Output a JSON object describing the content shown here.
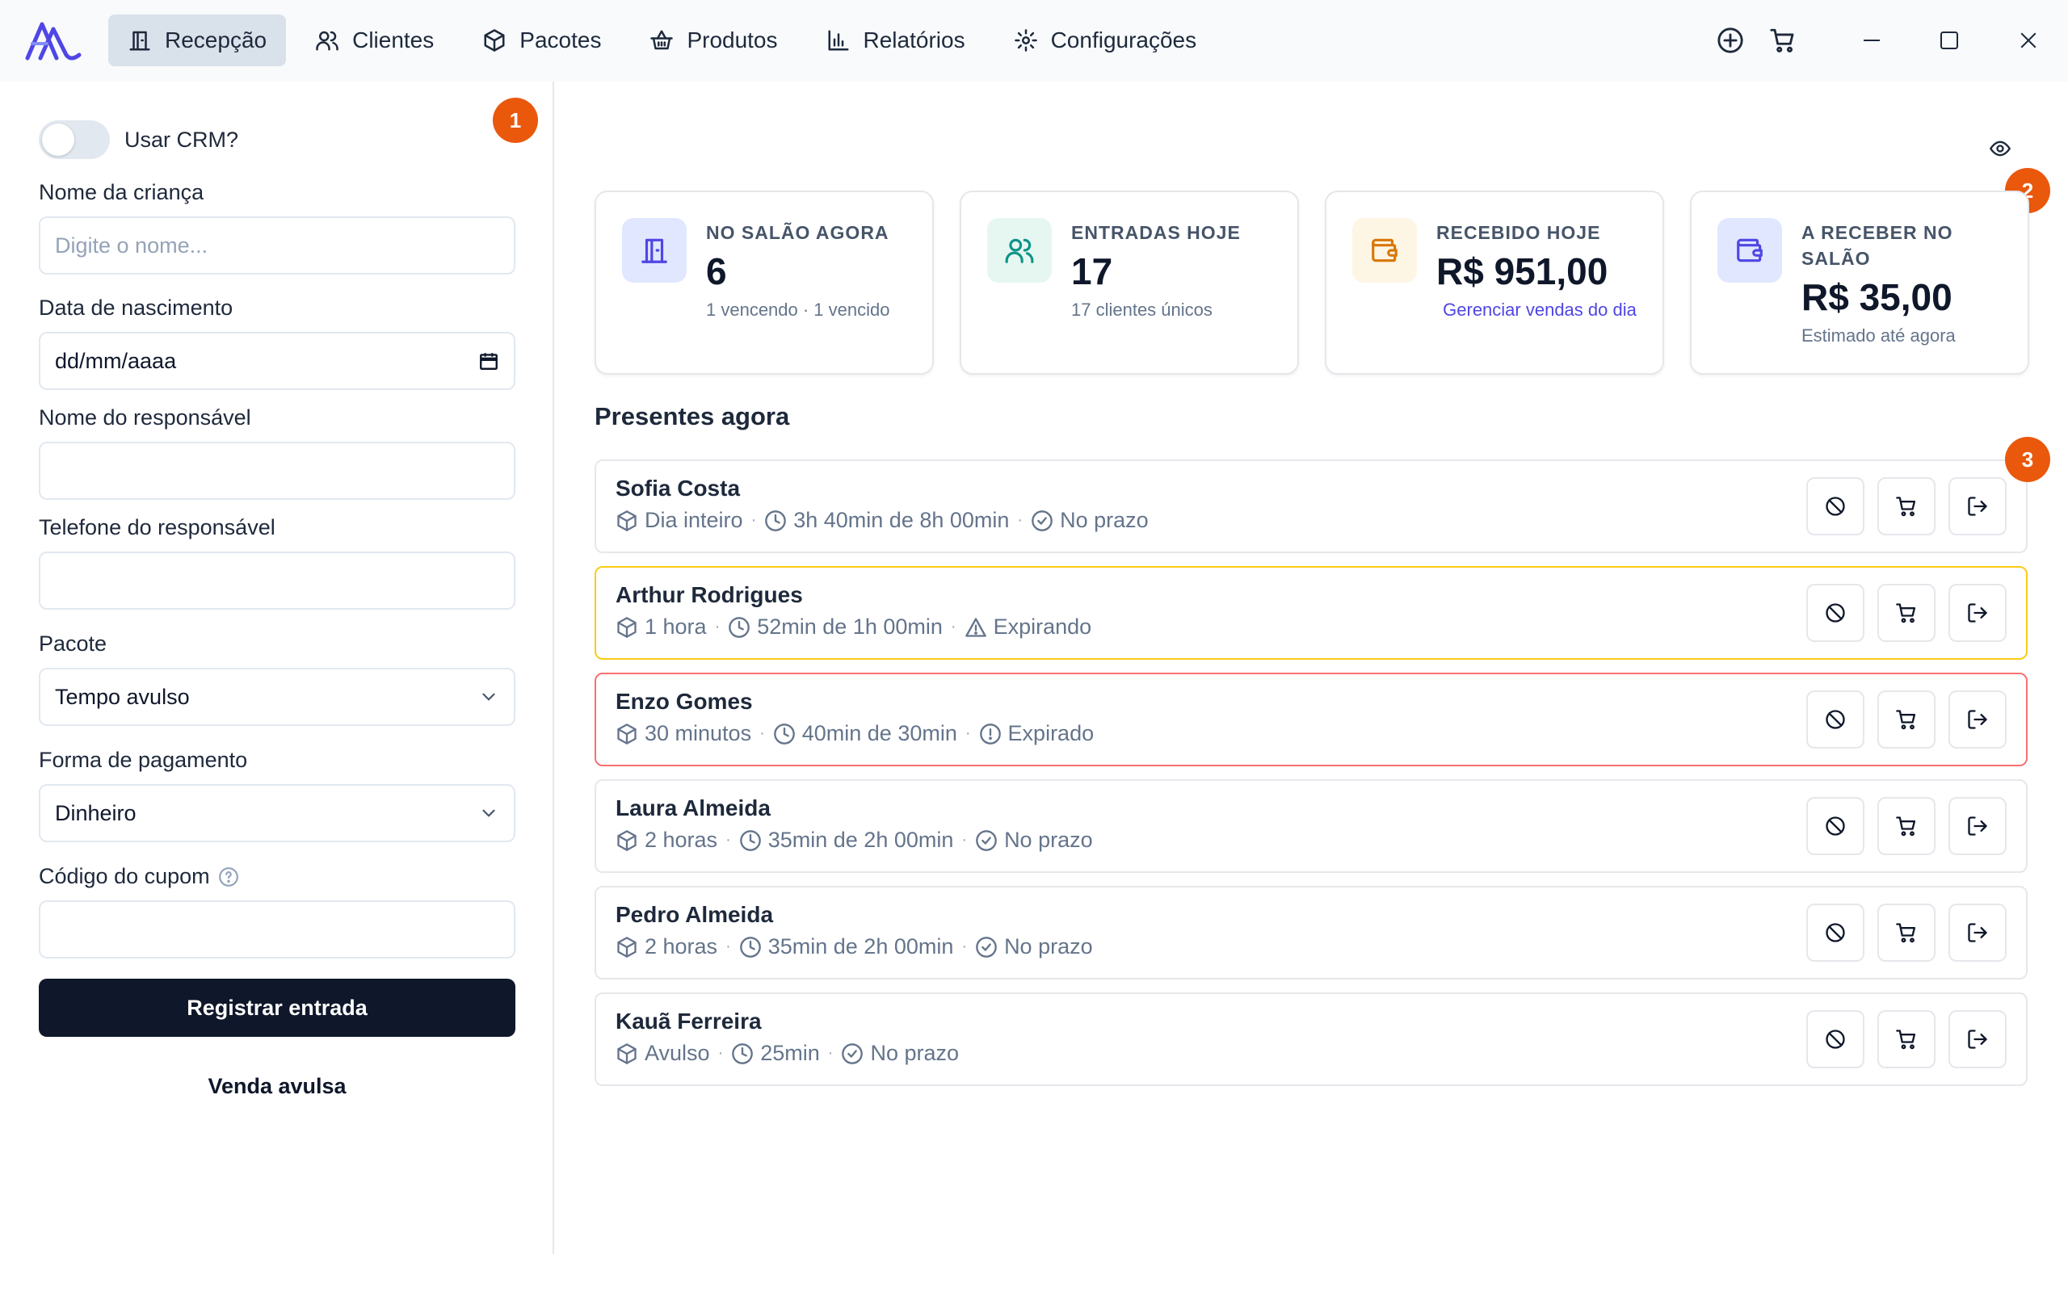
{
  "nav": {
    "items": [
      {
        "label": "Recepção",
        "icon": "door-icon",
        "active": true
      },
      {
        "label": "Clientes",
        "icon": "users-icon"
      },
      {
        "label": "Pacotes",
        "icon": "package-icon"
      },
      {
        "label": "Produtos",
        "icon": "basket-icon"
      },
      {
        "label": "Relatórios",
        "icon": "bar-chart-icon"
      },
      {
        "label": "Configurações",
        "icon": "gear-icon"
      }
    ]
  },
  "form": {
    "crm_label": "Usar CRM?",
    "child_name_label": "Nome da criança",
    "child_name_placeholder": "Digite o nome...",
    "birth_date_label": "Data de nascimento",
    "birth_date_placeholder": "dd/mm/aaaa",
    "guardian_name_label": "Nome do responsável",
    "guardian_phone_label": "Telefone do responsável",
    "package_label": "Pacote",
    "package_value": "Tempo avulso",
    "payment_label": "Forma de pagamento",
    "payment_value": "Dinheiro",
    "coupon_label": "Código do cupom",
    "submit_label": "Registrar entrada",
    "single_sale_label": "Venda avulsa"
  },
  "badges": [
    "1",
    "2",
    "3"
  ],
  "stats": [
    {
      "title": "NO SALÃO AGORA",
      "value": "6",
      "sub": "1 vencendo · 1 vencido"
    },
    {
      "title": "ENTRADAS HOJE",
      "value": "17",
      "sub": "17 clientes únicos"
    },
    {
      "title": "RECEBIDO HOJE",
      "value": "R$ 951,00",
      "link": "Gerenciar vendas do dia"
    },
    {
      "title": "A RECEBER NO SALÃO",
      "value": "R$ 35,00",
      "sub": "Estimado até agora"
    }
  ],
  "present": {
    "title": "Presentes agora",
    "rows": [
      {
        "name": "Sofia Costa",
        "package": "Dia inteiro",
        "time": "3h 40min de 8h 00min",
        "status": "No prazo",
        "state": "ok"
      },
      {
        "name": "Arthur Rodrigues",
        "package": "1 hora",
        "time": "52min de 1h 00min",
        "status": "Expirando",
        "state": "warn"
      },
      {
        "name": "Enzo Gomes",
        "package": "30 minutos",
        "time": "40min de 30min",
        "status": "Expirado",
        "state": "danger"
      },
      {
        "name": "Laura Almeida",
        "package": "2 horas",
        "time": "35min de 2h 00min",
        "status": "No prazo",
        "state": "ok"
      },
      {
        "name": "Pedro Almeida",
        "package": "2 horas",
        "time": "35min de 2h 00min",
        "status": "No prazo",
        "state": "ok"
      },
      {
        "name": "Kauã Ferreira",
        "package": "Avulso",
        "time": "25min",
        "status": "No prazo",
        "state": "ok"
      }
    ]
  },
  "colors": {
    "accent": "#0f172a",
    "badge": "#ea580c",
    "warn_border": "#facc15",
    "danger_border": "#f87171",
    "link": "#4f46e5"
  }
}
